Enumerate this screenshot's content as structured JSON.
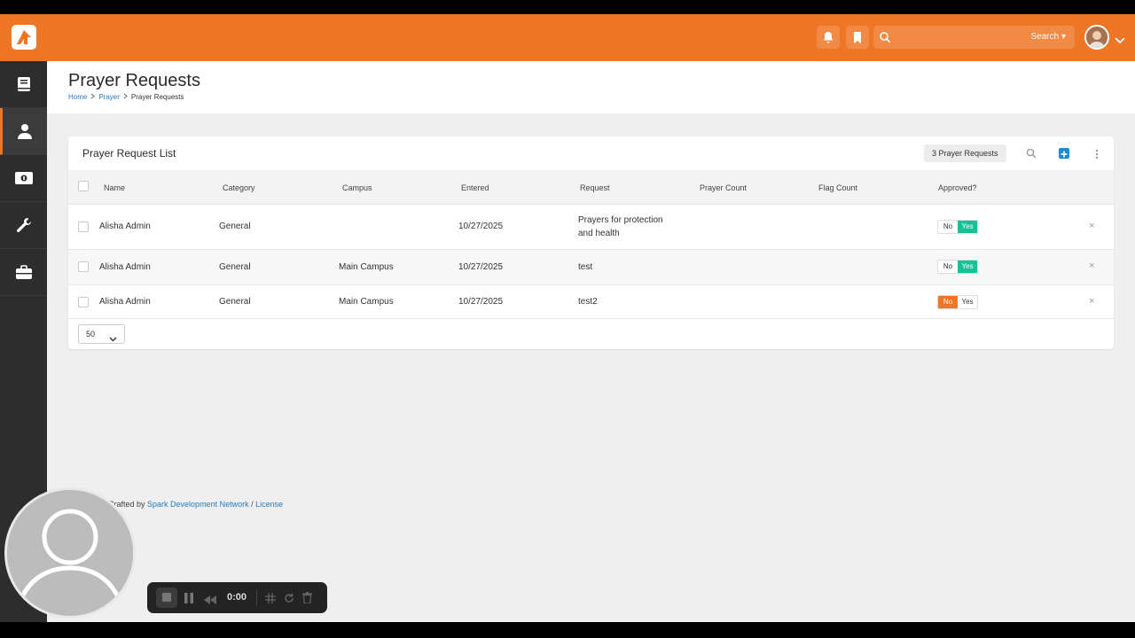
{
  "header": {
    "search_placeholder": "",
    "search_label": "Search ▾"
  },
  "sidebar": {
    "items": [
      {
        "icon": "book-icon"
      },
      {
        "icon": "user-icon",
        "active": true
      },
      {
        "icon": "money-icon"
      },
      {
        "icon": "wrench-icon"
      },
      {
        "icon": "briefcase-icon"
      }
    ]
  },
  "page": {
    "title": "Prayer Requests",
    "breadcrumb": [
      "Home",
      "Prayer",
      "Prayer Requests"
    ]
  },
  "panel": {
    "title": "Prayer Request List",
    "count_badge": "3 Prayer Requests",
    "columns": [
      "Name",
      "Category",
      "Campus",
      "Entered",
      "Request",
      "Prayer Count",
      "Flag Count",
      "Approved?"
    ],
    "rows": [
      {
        "name": "Alisha Admin",
        "category": "General",
        "campus": "",
        "entered": "10/27/2025",
        "request": "Prayers for protection and health",
        "approved": "Yes"
      },
      {
        "name": "Alisha Admin",
        "category": "General",
        "campus": "Main Campus",
        "entered": "10/27/2025",
        "request": "test",
        "approved": "Yes"
      },
      {
        "name": "Alisha Admin",
        "category": "General",
        "campus": "Main Campus",
        "entered": "10/27/2025",
        "request": "test2",
        "approved": "No"
      }
    ],
    "toggle_no": "No",
    "toggle_yes": "Yes",
    "delete_glyph": "×",
    "page_size": "50"
  },
  "footer": {
    "prefix": "Crafted by ",
    "link1": "Spark Development Network",
    "sep": " / ",
    "link2": "License"
  },
  "recorder": {
    "time": "0:00"
  },
  "colors": {
    "brand": "#ee7625",
    "yes": "#16c196",
    "link": "#2a7bbf"
  }
}
